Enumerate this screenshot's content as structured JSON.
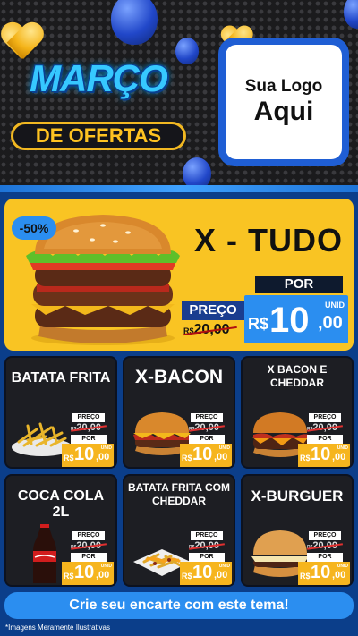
{
  "header": {
    "title_line1": "MARÇO",
    "title_line2": "DE OFERTAS",
    "logo_line1": "Sua Logo",
    "logo_line2": "Aqui"
  },
  "hero": {
    "discount": "-50%",
    "title": "X - TUDO",
    "preco_label": "PREÇO",
    "por_label": "POR",
    "old_currency": "R$",
    "old_price": "20,00",
    "new_currency": "R$",
    "new_int": "10",
    "new_dec": ",00",
    "unit": "UNID"
  },
  "price_labels": {
    "preco": "PREÇO",
    "por": "POR",
    "old_currency": "R$",
    "old_price": "20,00",
    "new_currency": "R$",
    "new_int": "10",
    "new_dec": ",00",
    "unit": "UNID"
  },
  "products": [
    {
      "name": "BATATA FRITA"
    },
    {
      "name": "X-BACON"
    },
    {
      "name": "X BACON E CHEDDAR"
    },
    {
      "name": "COCA COLA 2L"
    },
    {
      "name": "BATATA FRITA COM CHEDDAR"
    },
    {
      "name": "X-BURGUER"
    }
  ],
  "footer": {
    "cta": "Crie seu encarte com este tema!",
    "disclaimer": "*Imagens Meramente Ilustrativas"
  },
  "colors": {
    "background": "#0b3e8a",
    "accent_blue": "#2b8ef0",
    "hero_yellow": "#f9c423",
    "price_yellow": "#f6b51e",
    "card_dark": "#1d1e23"
  }
}
